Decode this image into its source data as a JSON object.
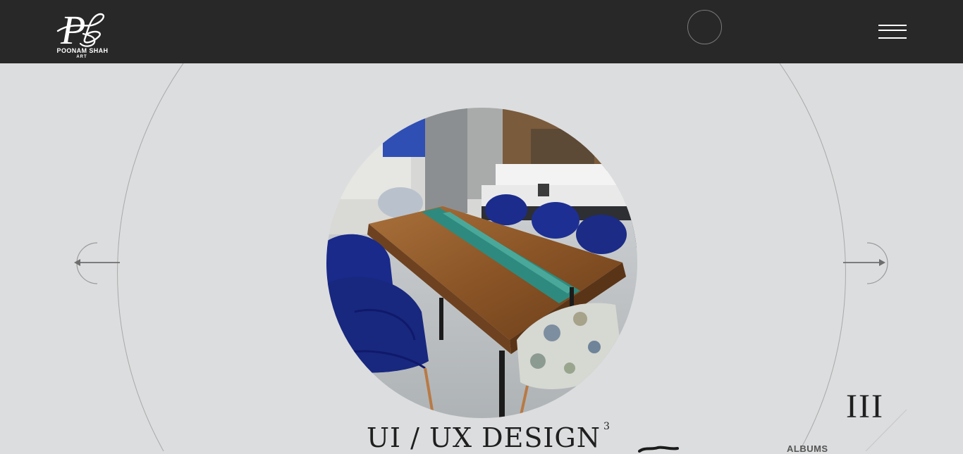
{
  "header": {
    "brand_name": "POONAM SHAH",
    "brand_sub": "ART",
    "logo_monogram": "PS",
    "menu_icon": "hamburger-menu-icon"
  },
  "slider": {
    "title": "UI / UX DESIGN",
    "title_superscript": "3",
    "index_numeral": "III",
    "albums_label": "ALBUMS",
    "prev_icon": "arrow-left-icon",
    "next_icon": "arrow-right-icon",
    "image_subject": "dining room with walnut river resin table and blue velvet chairs"
  },
  "colors": {
    "header_bg": "#282828",
    "page_bg": "#dcddde",
    "text_dark": "#1f1f1f"
  }
}
